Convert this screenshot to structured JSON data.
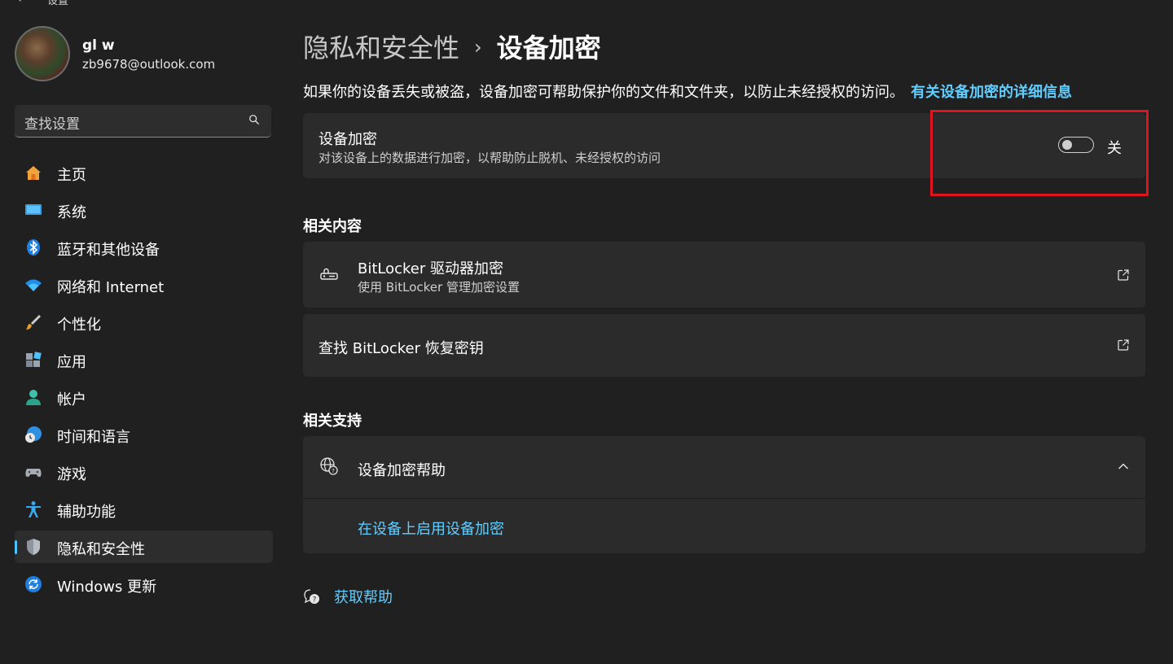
{
  "window": {
    "back_glyph": "←",
    "title": "设置"
  },
  "profile": {
    "name": "gl w",
    "email": "zb9678@outlook.com"
  },
  "search": {
    "placeholder": "查找设置"
  },
  "sidebar": {
    "items": [
      {
        "label": "主页",
        "icon": "home-icon"
      },
      {
        "label": "系统",
        "icon": "system-icon"
      },
      {
        "label": "蓝牙和其他设备",
        "icon": "bluetooth-icon"
      },
      {
        "label": "网络和 Internet",
        "icon": "wifi-icon"
      },
      {
        "label": "个性化",
        "icon": "brush-icon"
      },
      {
        "label": "应用",
        "icon": "apps-icon"
      },
      {
        "label": "帐户",
        "icon": "account-icon"
      },
      {
        "label": "时间和语言",
        "icon": "time-language-icon"
      },
      {
        "label": "游戏",
        "icon": "gaming-icon"
      },
      {
        "label": "辅助功能",
        "icon": "accessibility-icon"
      },
      {
        "label": "隐私和安全性",
        "icon": "shield-icon",
        "active": true
      },
      {
        "label": "Windows 更新",
        "icon": "update-icon"
      }
    ]
  },
  "main": {
    "breadcrumb": {
      "parent": "隐私和安全性",
      "separator": "›",
      "current": "设备加密"
    },
    "intro": {
      "text": "如果你的设备丢失或被盗，设备加密可帮助保护你的文件和文件夹，以防止未经授权的访问。",
      "link": "有关设备加密的详细信息"
    },
    "encryption_card": {
      "title": "设备加密",
      "subtitle": "对该设备上的数据进行加密，以帮助防止脱机、未经授权的访问",
      "toggle_state": "关",
      "toggle_on": false
    },
    "related_content": {
      "heading": "相关内容",
      "items": [
        {
          "title": "BitLocker 驱动器加密",
          "subtitle": "使用 BitLocker 管理加密设置",
          "icon": "bitlocker-key-icon"
        },
        {
          "title": "查找 BitLocker 恢复密钥"
        }
      ]
    },
    "related_support": {
      "heading": "相关支持",
      "help_title": "设备加密帮助",
      "help_link": "在设备上启用设备加密"
    },
    "get_help": "获取帮助"
  },
  "colors": {
    "background": "#202020",
    "card": "#2b2b2b",
    "accent": "#60cdff",
    "highlight": "#e0141e"
  }
}
